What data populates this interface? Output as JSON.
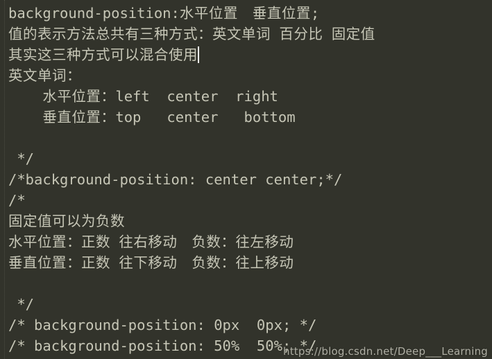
{
  "editor": {
    "background_color": "#32332b",
    "text_color": "#c6c6b6",
    "caret_color": "#f4f4f0",
    "indent_guide_color": "#4b4c42",
    "language": "CSS",
    "lines": [
      {
        "id": 1,
        "text": "background-position:水平位置　垂直位置;",
        "blank": false,
        "caret": false
      },
      {
        "id": 2,
        "text": "值的表示方法总共有三种方式：英文单词 百分比 固定值",
        "blank": false,
        "caret": false
      },
      {
        "id": 3,
        "text": "其实这三种方式可以混合使用",
        "blank": false,
        "caret": true
      },
      {
        "id": 4,
        "text": "英文单词：",
        "blank": false,
        "caret": false
      },
      {
        "id": 5,
        "text": "    水平位置：left  center  right",
        "blank": false,
        "caret": false
      },
      {
        "id": 6,
        "text": "    垂直位置：top   center   bottom",
        "blank": false,
        "caret": false
      },
      {
        "id": 7,
        "text": "",
        "blank": true,
        "caret": false
      },
      {
        "id": 8,
        "text": " */",
        "blank": false,
        "caret": false
      },
      {
        "id": 9,
        "text": "/*background-position: center center;*/",
        "blank": false,
        "caret": false
      },
      {
        "id": 10,
        "text": "/*",
        "blank": false,
        "caret": false
      },
      {
        "id": 11,
        "text": "固定值可以为负数",
        "blank": false,
        "caret": false
      },
      {
        "id": 12,
        "text": "水平位置：正数 往右移动　负数：往左移动",
        "blank": false,
        "caret": false
      },
      {
        "id": 13,
        "text": "垂直位置：正数 往下移动　负数：往上移动",
        "blank": false,
        "caret": false
      },
      {
        "id": 14,
        "text": "",
        "blank": true,
        "caret": false
      },
      {
        "id": 15,
        "text": " */",
        "blank": false,
        "caret": false
      },
      {
        "id": 16,
        "text": "/* background-position: 0px  0px; */",
        "blank": false,
        "caret": false
      },
      {
        "id": 17,
        "text": "/* background-position: 50%  50%; */",
        "blank": false,
        "caret": false
      }
    ]
  },
  "watermark": {
    "text": "https://blog.csdn.net/Deep___Learning"
  }
}
